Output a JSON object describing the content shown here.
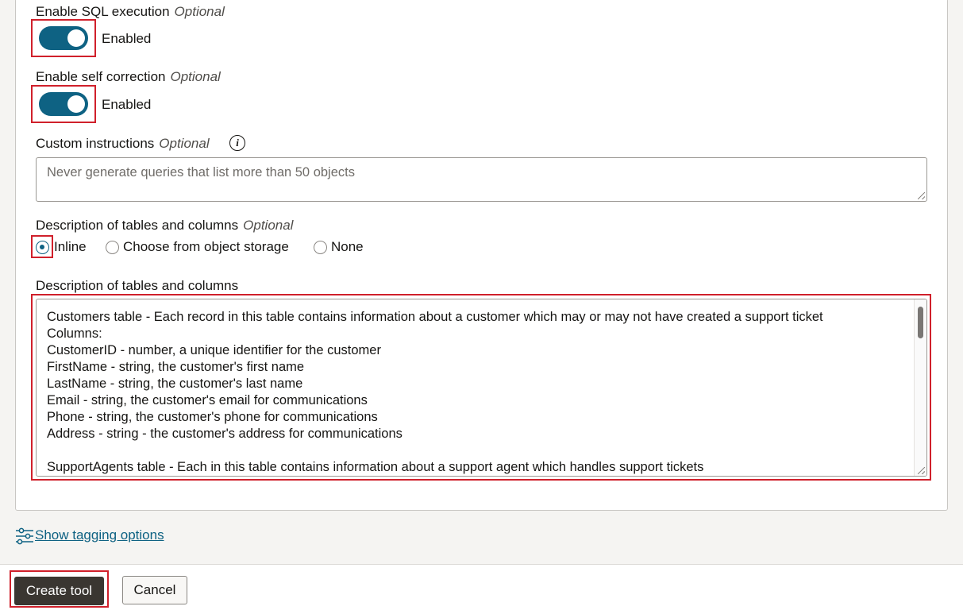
{
  "sql_execution": {
    "label": "Enable SQL execution",
    "optional": "Optional",
    "state_text": "Enabled"
  },
  "self_correction": {
    "label": "Enable self correction",
    "optional": "Optional",
    "state_text": "Enabled"
  },
  "custom_instructions": {
    "label": "Custom instructions",
    "optional": "Optional",
    "placeholder": "Never generate queries that list more than 50 objects"
  },
  "description_source": {
    "label": "Description of tables and columns",
    "optional": "Optional",
    "options": [
      {
        "label": "Inline",
        "selected": true
      },
      {
        "label": "Choose from object storage",
        "selected": false
      },
      {
        "label": "None",
        "selected": false
      }
    ]
  },
  "description_text": {
    "label": "Description of tables and columns",
    "lines": [
      "Customers table - Each record in this table contains information about a customer which may or may not have created a support ticket",
      "Columns:",
      "CustomerID - number, a unique identifier for the customer",
      "FirstName - string, the customer's first name",
      "LastName - string, the customer's last name",
      "Email - string, the customer's email for communications",
      "Phone - string, the customer's phone for communications",
      "Address - string - the customer's address for communications",
      "",
      "SupportAgents table - Each in this table contains information about a support agent which handles support tickets"
    ]
  },
  "tagging": {
    "link_text": "Show tagging options"
  },
  "footer": {
    "create_label": "Create tool",
    "cancel_label": "Cancel"
  },
  "colors": {
    "accent": "#0e6283",
    "highlight": "#d0202b",
    "primary_button": "#3a3631"
  }
}
